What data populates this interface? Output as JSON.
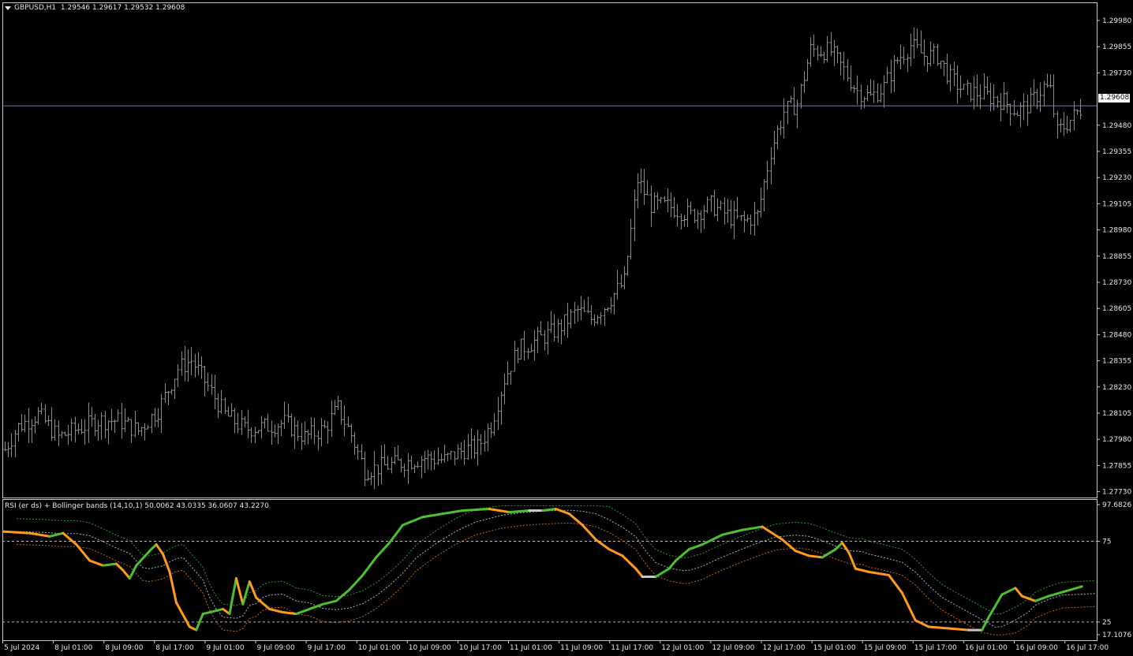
{
  "header": {
    "symbol": "GBPUSD,H1",
    "ohlc": "1.29546 1.29617 1.29532 1.29608"
  },
  "price_axis": {
    "ticks": [
      "1.29980",
      "1.29855",
      "1.29730",
      "1.29480",
      "1.29355",
      "1.29230",
      "1.29105",
      "1.28980",
      "1.28855",
      "1.28730",
      "1.28605",
      "1.28480",
      "1.28355",
      "1.28230",
      "1.28105",
      "1.27980",
      "1.27855",
      "1.27730"
    ],
    "current_price": "1.29608"
  },
  "indicator": {
    "title": "RSI (er ds) + Bollinger bands (14,10,1) 50.0062 43.0335 36.0607 43.2270",
    "axis_max": "97.6826",
    "level_high": "75",
    "level_low": "25",
    "axis_min": "17.1076"
  },
  "time_axis": {
    "labels": [
      "5 Jul 2024",
      "8 Jul 01:00",
      "8 Jul 09:00",
      "8 Jul 17:00",
      "9 Jul 01:00",
      "9 Jul 09:00",
      "9 Jul 17:00",
      "10 Jul 01:00",
      "10 Jul 09:00",
      "10 Jul 17:00",
      "11 Jul 01:00",
      "11 Jul 09:00",
      "11 Jul 17:00",
      "12 Jul 01:00",
      "12 Jul 09:00",
      "12 Jul 17:00",
      "15 Jul 01:00",
      "15 Jul 09:00",
      "15 Jul 17:00",
      "16 Jul 01:00",
      "16 Jul 09:00",
      "16 Jul 17:00"
    ]
  },
  "colors": {
    "background": "#000000",
    "frame": "#c8c8c8",
    "bars": "#8c8c8c",
    "bull_bar": "#3cb43c",
    "price_line": "#6e7f9c",
    "rsi_up": "#4cc030",
    "rsi_down": "#ff9a1a",
    "rsi_neutral": "#c8c8c8",
    "band_upper": "#2e9a2e",
    "band_lower": "#c46a1a",
    "band_mid": "#b4b4b4"
  },
  "chart_data": {
    "type": "line",
    "symbol": "GBPUSD",
    "timeframe": "H1",
    "ylim": [
      1.2773,
      1.3005
    ],
    "close_path": [
      [
        1.2795,
        0
      ],
      [
        1.2806,
        4
      ],
      [
        1.2812,
        10
      ],
      [
        1.2801,
        16
      ],
      [
        1.2805,
        22
      ],
      [
        1.2809,
        28
      ],
      [
        1.2809,
        34
      ],
      [
        1.2804,
        40
      ],
      [
        1.2814,
        46
      ],
      [
        1.2834,
        52
      ],
      [
        1.2838,
        56
      ],
      [
        1.2828,
        60
      ],
      [
        1.2812,
        66
      ],
      [
        1.2805,
        72
      ],
      [
        1.2806,
        78
      ],
      [
        1.2808,
        84
      ],
      [
        1.2801,
        90
      ],
      [
        1.2805,
        96
      ],
      [
        1.2815,
        100
      ],
      [
        1.2802,
        104
      ],
      [
        1.2785,
        108
      ],
      [
        1.2787,
        114
      ],
      [
        1.2789,
        120
      ],
      [
        1.2791,
        126
      ],
      [
        1.279,
        132
      ],
      [
        1.2795,
        138
      ],
      [
        1.2796,
        142
      ],
      [
        1.2807,
        146
      ],
      [
        1.2829,
        150
      ],
      [
        1.2843,
        154
      ],
      [
        1.2848,
        160
      ],
      [
        1.2853,
        166
      ],
      [
        1.2862,
        172
      ],
      [
        1.2858,
        176
      ],
      [
        1.2864,
        180
      ],
      [
        1.2876,
        186
      ],
      [
        1.2925,
        190
      ],
      [
        1.2913,
        194
      ],
      [
        1.2912,
        200
      ],
      [
        1.2908,
        206
      ],
      [
        1.2913,
        212
      ],
      [
        1.2907,
        218
      ],
      [
        1.2905,
        222
      ],
      [
        1.2908,
        226
      ],
      [
        1.2939,
        230
      ],
      [
        1.2958,
        234
      ],
      [
        1.2962,
        238
      ],
      [
        1.2988,
        242
      ],
      [
        1.2987,
        248
      ],
      [
        1.2978,
        252
      ],
      [
        1.2968,
        256
      ],
      [
        1.2965,
        260
      ],
      [
        1.297,
        264
      ],
      [
        1.2983,
        268
      ],
      [
        1.299,
        272
      ],
      [
        1.2985,
        276
      ],
      [
        1.2985,
        280
      ],
      [
        1.2974,
        284
      ],
      [
        1.2968,
        288
      ],
      [
        1.2967,
        292
      ],
      [
        1.2965,
        296
      ],
      [
        1.2963,
        300
      ],
      [
        1.2958,
        304
      ],
      [
        1.2962,
        308
      ],
      [
        1.297,
        312
      ],
      [
        1.2968,
        314
      ],
      [
        1.2948,
        316
      ],
      [
        1.2954,
        320
      ],
      [
        1.2961,
        324
      ]
    ],
    "rsi_levels": [
      75,
      25
    ],
    "rsi_last": 50.0062,
    "bands_last": [
      43.0335,
      36.0607,
      43.227
    ]
  }
}
